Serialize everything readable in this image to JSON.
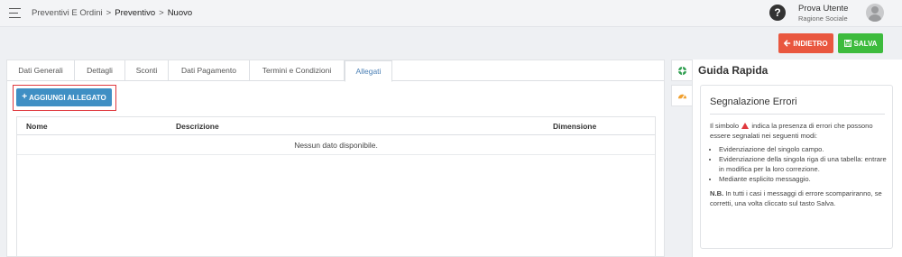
{
  "header": {
    "breadcrumb": [
      "Preventivi E Ordini",
      "Preventivo",
      "Nuovo"
    ],
    "separator": ">",
    "help_glyph": "?",
    "user_name": "Prova Utente",
    "user_company": "Ragione Sociale"
  },
  "actions": {
    "back_label": "INDIETRO",
    "save_label": "SALVA",
    "back_color": "#e9573f",
    "save_color": "#3dbb3d"
  },
  "tabs": [
    {
      "label": "Dati Generali",
      "active": false
    },
    {
      "label": "Dettagli",
      "active": false
    },
    {
      "label": "Sconti",
      "active": false
    },
    {
      "label": "Dati Pagamento",
      "active": false
    },
    {
      "label": "Termini e Condizioni",
      "active": false
    },
    {
      "label": "Allegati",
      "active": true
    }
  ],
  "attachments": {
    "add_label": "AGGIUNGI ALLEGATO",
    "columns": [
      "Nome",
      "Descrizione",
      "Dimensione"
    ],
    "empty_text": "Nessun dato disponibile."
  },
  "guide": {
    "title": "Guida Rapida",
    "card_title": "Segnalazione Errori",
    "intro_before": "Il simbolo",
    "intro_after": "indica la presenza di errori che possono essere segnalati nei seguenti modi:",
    "bullets": [
      "Evidenziazione del singolo campo.",
      "Evidenziazione della singola riga di una tabella: entrare in modifica per la loro correzione.",
      "Mediante esplicito messaggio."
    ],
    "note_label": "N.B.",
    "note_text": "In tutti i casi i messaggi di errore scompariranno, se corretti, una volta cliccato sul tasto Salva."
  },
  "icons": {
    "hamburger": "menu-icon",
    "help": "help-circle-icon",
    "avatar": "user-avatar-icon",
    "back": "arrow-left-icon",
    "save": "floppy-disk-icon",
    "add": "plus-icon",
    "side_guide": "life-ring-icon",
    "side_dashboard": "gauge-icon",
    "warning": "warning-triangle-icon"
  }
}
